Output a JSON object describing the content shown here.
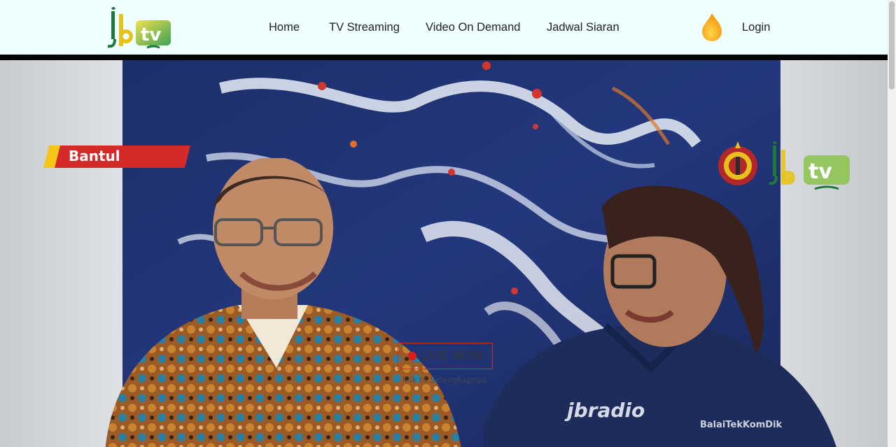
{
  "nav": {
    "items": [
      {
        "label": "Home"
      },
      {
        "label": "TV Streaming"
      },
      {
        "label": "Video On Demand"
      },
      {
        "label": "Jadwal Siaran"
      }
    ],
    "login_label": "Login"
  },
  "logo": {
    "left_part": "jb",
    "right_part": "tv"
  },
  "overlay": {
    "location": "Bantul",
    "live_label": "LIVE NOW",
    "live_sub": "Klik to Selengkapnya"
  },
  "watermark": {
    "left_part": "jb",
    "right_part": "tv"
  },
  "colors": {
    "navbar_bg": "#effefe",
    "nav_border": "#050505",
    "location_red": "#d42a2a",
    "location_yellow": "#f5c518",
    "live_red": "#e01b1b",
    "logo_green": "#1e7a3a",
    "logo_yellow": "#e8c21c",
    "flame_orange": "#f5a623"
  },
  "icons": [
    "jogjatv-logo",
    "flame-icon",
    "keraton-emblem-icon"
  ]
}
